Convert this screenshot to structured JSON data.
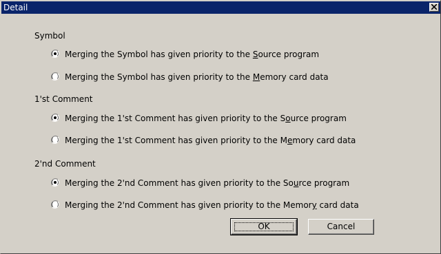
{
  "window": {
    "title": "Detail"
  },
  "groups": [
    {
      "label": "Symbol",
      "options": [
        {
          "pre": "Merging the Symbol has given priority to the ",
          "acc": "S",
          "post": "ource program",
          "selected": true
        },
        {
          "pre": "Merging the Symbol has given priority to the ",
          "acc": "M",
          "post": "emory card data",
          "selected": false
        }
      ]
    },
    {
      "label": "1'st Comment",
      "options": [
        {
          "pre": "Merging the 1'st Comment has given priority to the S",
          "acc": "o",
          "post": "urce program",
          "selected": true
        },
        {
          "pre": "Merging the 1'st Comment has given priority to the M",
          "acc": "e",
          "post": "mory card data",
          "selected": false
        }
      ]
    },
    {
      "label": "2'nd Comment",
      "options": [
        {
          "pre": "Merging the 2'nd Comment has given priority to the So",
          "acc": "u",
          "post": "rce program",
          "selected": true
        },
        {
          "pre": "Merging the 2'nd Comment has given priority to the Memor",
          "acc": "y",
          "post": " card data",
          "selected": false
        }
      ]
    }
  ],
  "buttons": {
    "ok": "OK",
    "cancel": "Cancel"
  }
}
